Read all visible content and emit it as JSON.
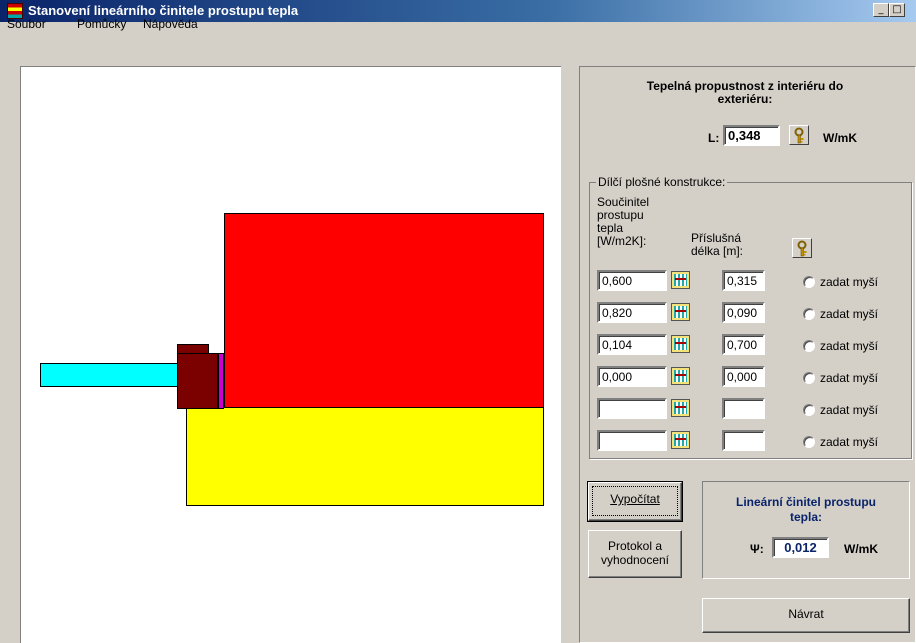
{
  "window": {
    "title": "Stanovení lineárního činitele prostupu tepla",
    "minimize_glyph": "_",
    "maximize_glyph": "□"
  },
  "menu": [
    "Soubor",
    "Pomůcky",
    "Nápověda"
  ],
  "shapes": [
    {
      "name": "interior-rect",
      "color": "#ff0000"
    },
    {
      "name": "exterior-rect",
      "color": "#ffff00"
    },
    {
      "name": "window-frame",
      "color": "#7b0000"
    },
    {
      "name": "glazing-bar",
      "color": "#00ffff"
    },
    {
      "name": "insulation-strip",
      "color": "#cc00cc"
    }
  ],
  "top_panel": {
    "title": "Tepelná propustnost z interiéru do exteriéru:",
    "l_label": "L:",
    "l_value": "0,348",
    "l_unit": "W/mK"
  },
  "partial": {
    "group_title": "Dílčí plošné konstrukce:",
    "col1_header": "Součinitel prostupu tepla [W/m2K]:",
    "col2_header": "Příslušná délka [m]:",
    "radio_label": "zadat myší",
    "rows": [
      {
        "u": "0,600",
        "len": "0,315"
      },
      {
        "u": "0,820",
        "len": "0,090"
      },
      {
        "u": "0,104",
        "len": "0,700"
      },
      {
        "u": "0,000",
        "len": "0,000"
      },
      {
        "u": "",
        "len": ""
      },
      {
        "u": "",
        "len": ""
      }
    ]
  },
  "buttons": {
    "calculate": "Vypočítat",
    "protocol": "Protokol a vyhodnocení",
    "back": "Návrat"
  },
  "result": {
    "title": "Lineární činitel prostupu tepla:",
    "psi_label": "Ψ:",
    "value": "0,012",
    "unit": "W/mK"
  }
}
